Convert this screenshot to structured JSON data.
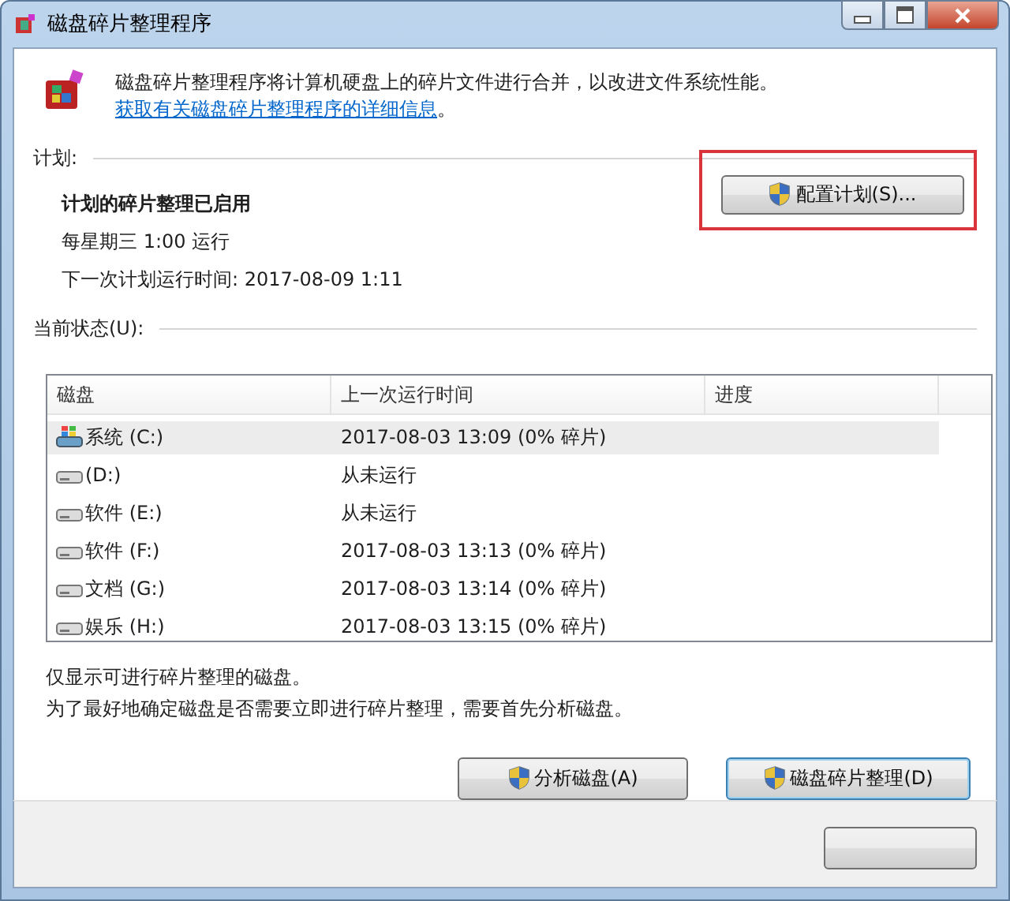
{
  "window": {
    "title": "磁盘碎片整理程序"
  },
  "intro": {
    "text": "磁盘碎片整理程序将计算机硬盘上的碎片文件进行合并，以改进文件系统性能。",
    "link": "获取有关磁盘碎片整理程序的详细信息",
    "after": "。"
  },
  "schedule": {
    "heading": "计划:",
    "status": "计划的碎片整理已启用",
    "frequency": "每星期三  1:00 运行",
    "next_run": "下一次计划运行时间: 2017-08-09 1:11",
    "button": "配置计划(S)...",
    "highlighted": true
  },
  "current_status": {
    "heading": "当前状态(U):"
  },
  "table": {
    "columns": [
      "磁盘",
      "上一次运行时间",
      "进度"
    ],
    "rows": [
      {
        "disk": "系统 (C:)",
        "kind": "system",
        "last_run": "2017-08-03 13:09 (0% 碎片)",
        "selected": true
      },
      {
        "disk": "(D:)",
        "kind": "drive",
        "last_run": "从未运行",
        "selected": false
      },
      {
        "disk": "软件 (E:)",
        "kind": "drive",
        "last_run": "从未运行",
        "selected": false
      },
      {
        "disk": "软件 (F:)",
        "kind": "drive",
        "last_run": "2017-08-03 13:13 (0% 碎片)",
        "selected": false
      },
      {
        "disk": "文档 (G:)",
        "kind": "drive",
        "last_run": "2017-08-03 13:14 (0% 碎片)",
        "selected": false
      },
      {
        "disk": "娱乐 (H:)",
        "kind": "drive",
        "last_run": "2017-08-03 13:15 (0% 碎片)",
        "selected": false
      }
    ]
  },
  "notes": [
    "仅显示可进行碎片整理的磁盘。",
    "为了最好地确定磁盘是否需要立即进行碎片整理，需要首先分析磁盘。"
  ],
  "buttons": [
    {
      "label": "分析磁盘(A)",
      "focused": false
    },
    {
      "label": "磁盘碎片整理(D)",
      "focused": true
    }
  ]
}
